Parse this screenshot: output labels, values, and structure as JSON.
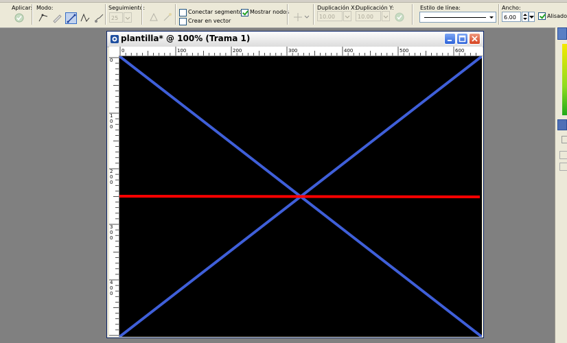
{
  "toolbar": {
    "apply_label": "Aplicar:",
    "mode_label": "Modo:",
    "tracking_label": "Seguimiento:",
    "tracking_value": "25",
    "connect_segments_label": "Conectar segmentos",
    "connect_segments_checked": false,
    "show_nodes_label": "Mostrar nodos",
    "show_nodes_checked": true,
    "create_vector_label": "Crear en vector",
    "create_vector_checked": false,
    "dup_x_label": "Duplicación X:",
    "dup_x_value": "10.00",
    "dup_y_label": "Duplicación Y:",
    "dup_y_value": "10.00",
    "line_style_label": "Estilo de línea:",
    "width_label": "Ancho:",
    "width_value": "6.00",
    "antialias_label": "Alisado",
    "antialias_checked": true
  },
  "document": {
    "title": "plantilla* @ 100% (Trama 1)",
    "ruler_h_labels": [
      "0",
      "100",
      "200",
      "300",
      "400",
      "500",
      "600"
    ],
    "ruler_v_labels": [
      [
        "0"
      ],
      [
        "1",
        "0",
        "0"
      ],
      [
        "2",
        "0",
        "0"
      ],
      [
        "3",
        "0",
        "0"
      ],
      [
        "4",
        "0",
        "0"
      ]
    ],
    "canvas_background": "#000000",
    "line_colors": {
      "diagonals": "#3f5fd9",
      "horizontal": "#ff0000"
    }
  }
}
